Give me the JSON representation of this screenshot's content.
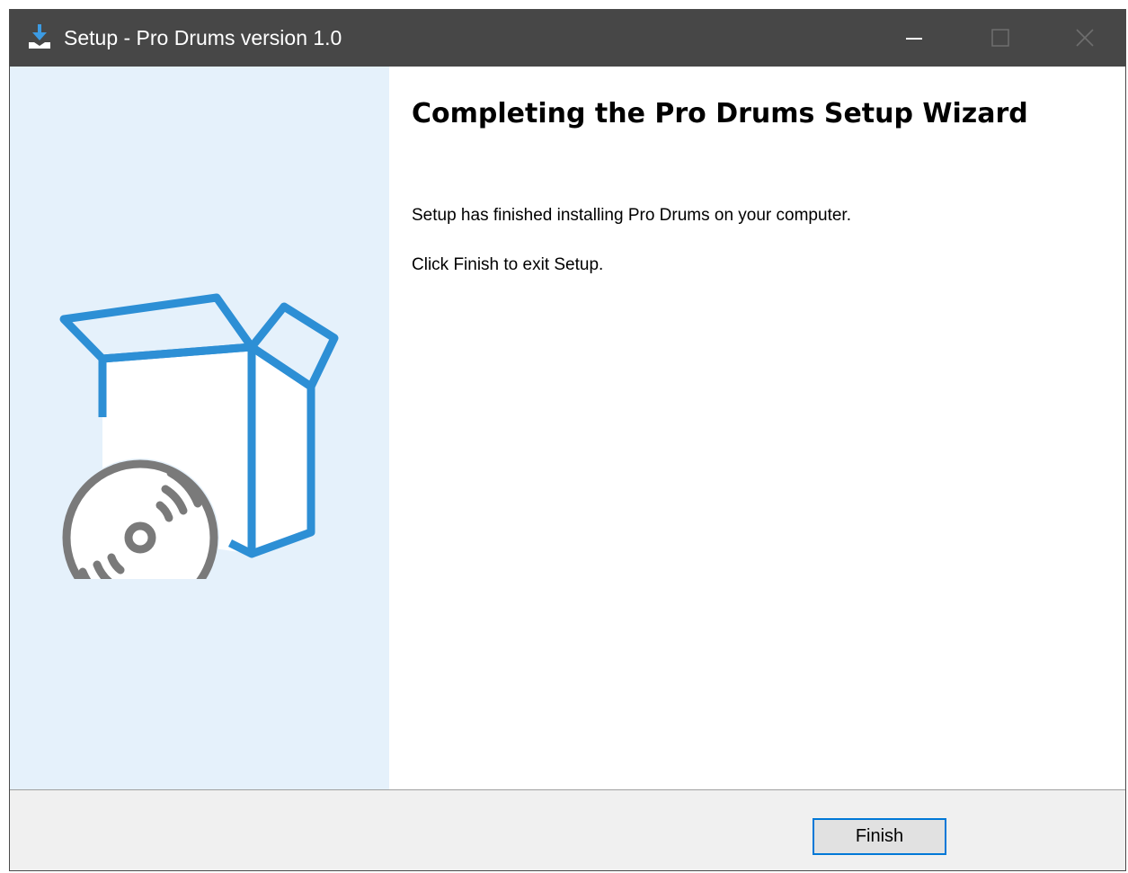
{
  "window": {
    "title": "Setup - Pro Drums version 1.0",
    "icon": "installer-download-icon",
    "controls": [
      "minimize-icon",
      "maximize-icon",
      "close-icon"
    ]
  },
  "sidebar": {
    "illustration": "software-box-with-disc-icon",
    "background_color": "#e5f1fb",
    "accent_color": "#2d8fd5"
  },
  "content": {
    "heading": "Completing the Pro Drums Setup Wizard",
    "paragraphs": [
      "Setup has finished installing Pro Drums on your computer.",
      "Click Finish to exit Setup."
    ]
  },
  "footer": {
    "finish_label": "Finish"
  },
  "colors": {
    "titlebar": "#474747",
    "button_focus_border": "#0078d7",
    "footer": "#f0f0f0"
  }
}
